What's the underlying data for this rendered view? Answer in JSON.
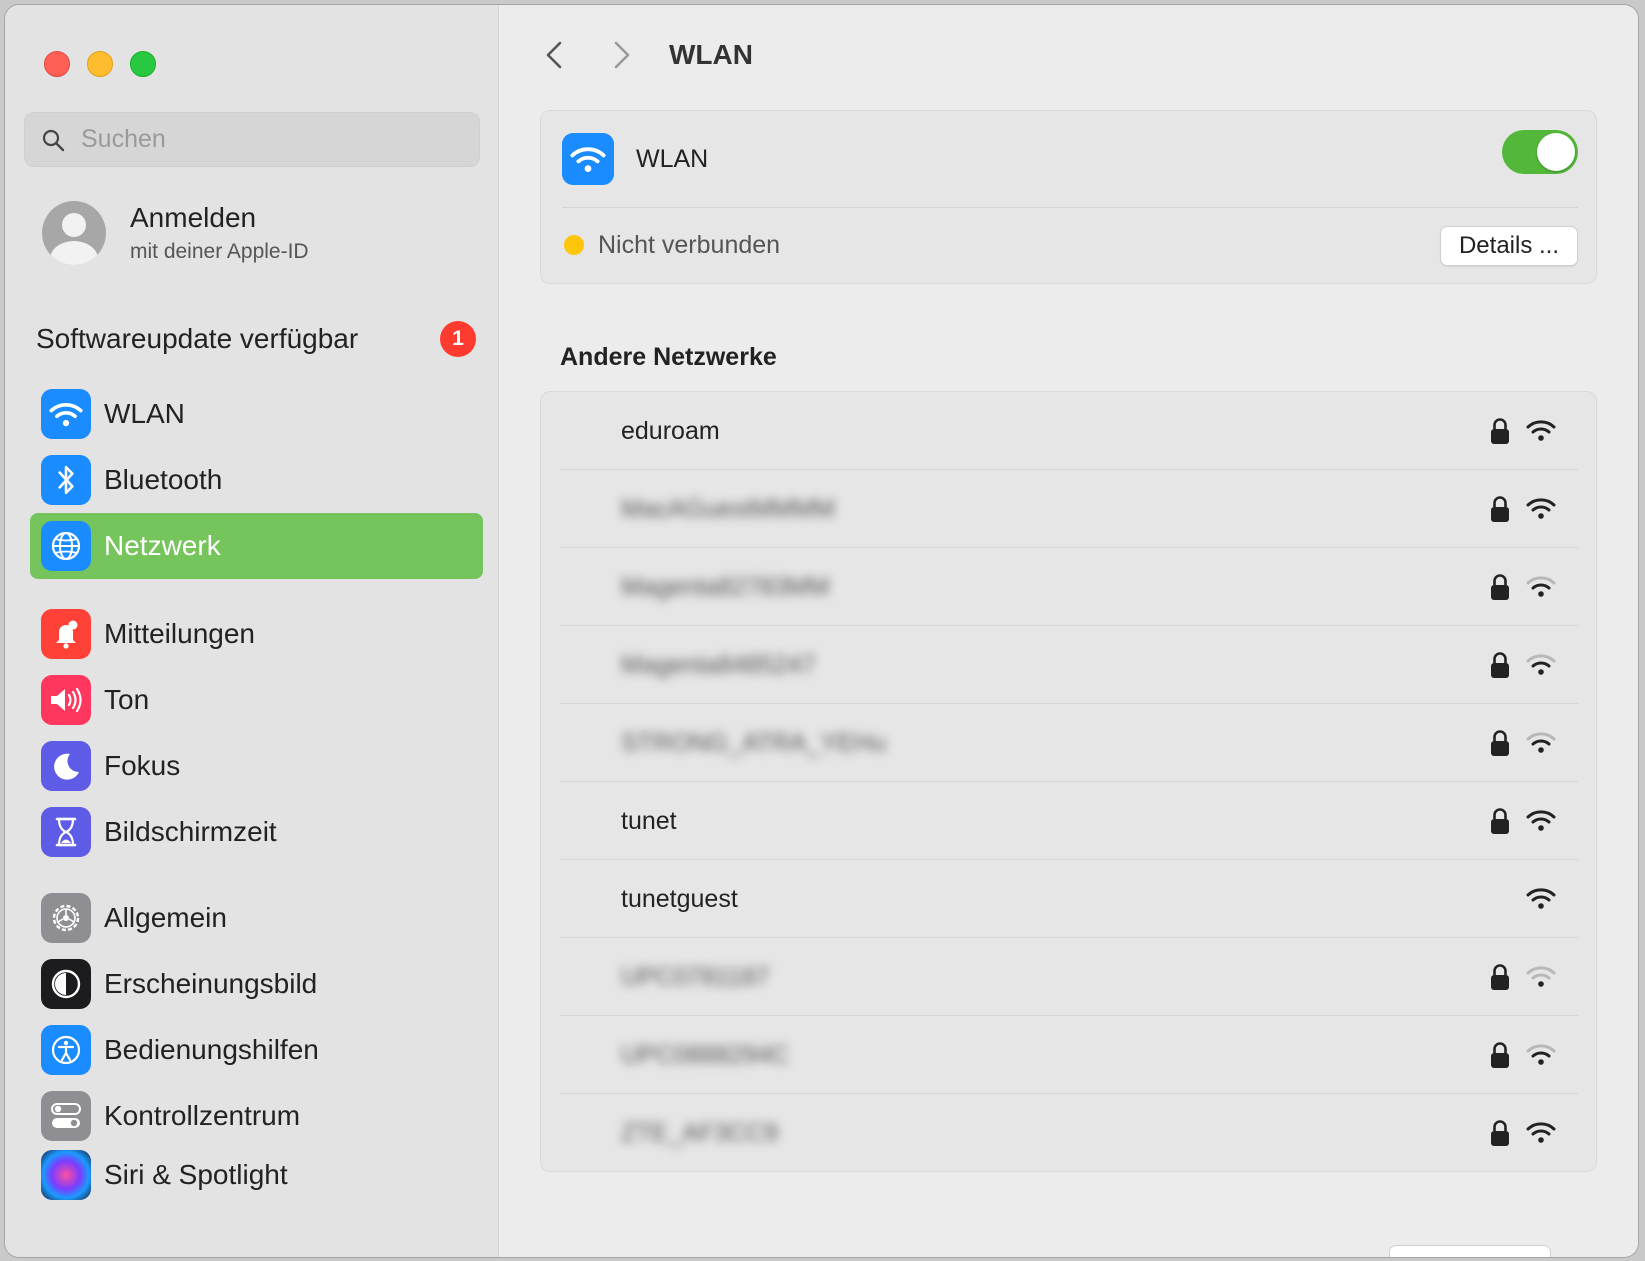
{
  "sidebar": {
    "search_placeholder": "Suchen",
    "account": {
      "title": "Anmelden",
      "subtitle": "mit deiner Apple-ID"
    },
    "update": {
      "label": "Softwareupdate verfügbar",
      "badge": "1"
    },
    "items": [
      {
        "label": "WLAN",
        "icon": "wifi-icon",
        "color": "#1a8cff"
      },
      {
        "label": "Bluetooth",
        "icon": "bluetooth-icon",
        "color": "#1a8cff"
      },
      {
        "label": "Netzwerk",
        "icon": "globe-icon",
        "color": "#1a8cff",
        "active": true
      },
      {
        "label": "Mitteilungen",
        "icon": "bell-icon",
        "color": "#ff4137"
      },
      {
        "label": "Ton",
        "icon": "speaker-icon",
        "color": "#ff375f"
      },
      {
        "label": "Fokus",
        "icon": "moon-icon",
        "color": "#5e5ce6"
      },
      {
        "label": "Bildschirmzeit",
        "icon": "hourglass-icon",
        "color": "#5e5ce6"
      },
      {
        "label": "Allgemein",
        "icon": "gear-icon",
        "color": "#8e8e93"
      },
      {
        "label": "Erscheinungsbild",
        "icon": "appearance-icon",
        "color": "#1c1c1e"
      },
      {
        "label": "Bedienungshilfen",
        "icon": "accessibility-icon",
        "color": "#1a8cff"
      },
      {
        "label": "Kontrollzentrum",
        "icon": "control-center-icon",
        "color": "#8e8e93"
      },
      {
        "label": "Siri & Spotlight",
        "icon": "siri-icon",
        "color": "#2b2b6e"
      }
    ]
  },
  "main": {
    "title": "WLAN",
    "wlan_card": {
      "label": "WLAN",
      "toggle_on": true,
      "status": "Nicht verbunden",
      "details_button": "Details ..."
    },
    "other_networks_title": "Andere Netzwerke",
    "networks": [
      {
        "name": "eduroam",
        "blurred": false,
        "locked": true,
        "signal": "strong"
      },
      {
        "name": "MacAGuestMMMM",
        "blurred": true,
        "locked": true,
        "signal": "strong"
      },
      {
        "name": "Magenta82783MM",
        "blurred": true,
        "locked": true,
        "signal": "medium"
      },
      {
        "name": "Magenta8485247",
        "blurred": true,
        "locked": true,
        "signal": "medium"
      },
      {
        "name": "STRONG_ATRA_YEHu",
        "blurred": true,
        "locked": true,
        "signal": "medium"
      },
      {
        "name": "tunet",
        "blurred": false,
        "locked": true,
        "signal": "strong"
      },
      {
        "name": "tunetguest",
        "blurred": false,
        "locked": false,
        "signal": "strong"
      },
      {
        "name": "UPC0781187",
        "blurred": true,
        "locked": true,
        "signal": "weak"
      },
      {
        "name": "UPC0888294C",
        "blurred": true,
        "locked": true,
        "signal": "medium"
      },
      {
        "name": "ZTE_AF3CC9",
        "blurred": true,
        "locked": true,
        "signal": "strong"
      }
    ]
  },
  "colors": {
    "accent_green": "#76c45c",
    "toggle_green": "#53b73a",
    "status_yellow": "#fdc60a",
    "badge_red": "#ff3b30"
  }
}
